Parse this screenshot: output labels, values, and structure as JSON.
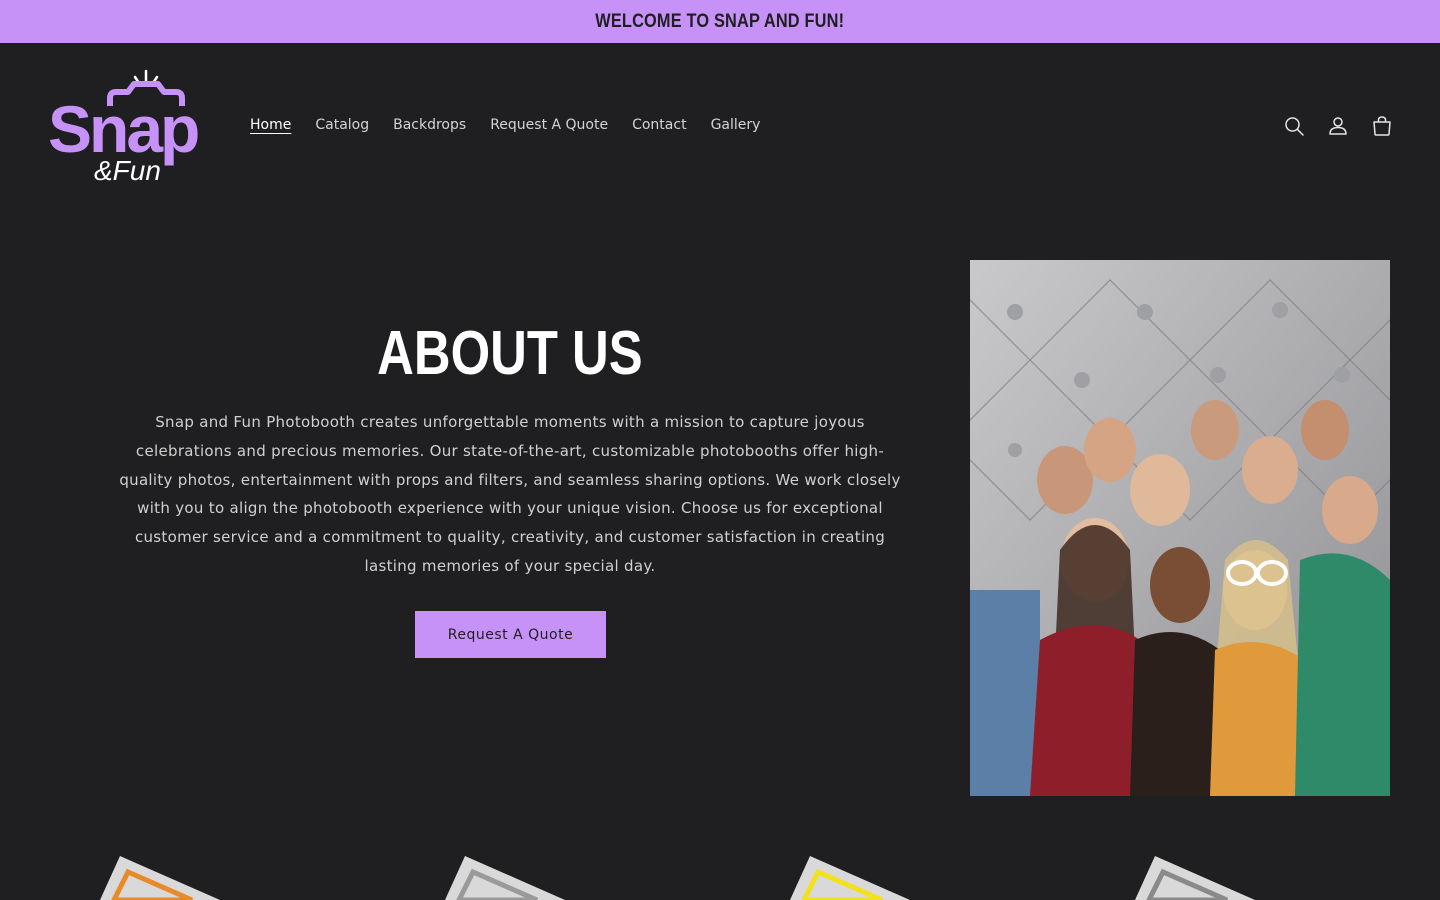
{
  "announcement": {
    "text": "WELCOME TO SNAP AND FUN!"
  },
  "brand": {
    "logo_text_main": "Snap",
    "logo_text_sub": "&Fun",
    "accent_color": "#c792f7"
  },
  "nav": {
    "items": [
      {
        "label": "Home",
        "active": true
      },
      {
        "label": "Catalog"
      },
      {
        "label": "Backdrops"
      },
      {
        "label": "Request A Quote"
      },
      {
        "label": "Contact"
      },
      {
        "label": "Gallery"
      }
    ]
  },
  "header_icons": [
    "search-icon",
    "account-icon",
    "cart-icon"
  ],
  "about": {
    "title": "ABOUT US",
    "body": "Snap and Fun Photobooth creates unforgettable moments with a mission to capture joyous celebrations and precious memories. Our state-of-the-art, customizable photobooths offer high-quality photos, entertainment with props and filters, and seamless sharing options. We work closely with you to align the photobooth experience with your unique vision. Choose us for exceptional customer service and a commitment to quality, creativity, and customer satisfaction in creating lasting memories of your special day.",
    "cta_label": "Request A Quote"
  },
  "products": [
    {
      "frame_color": "#e88a2a"
    },
    {
      "frame_color": "#9a9a9a"
    },
    {
      "frame_color": "#f2e11c"
    },
    {
      "frame_color": "#8a8a8a"
    }
  ]
}
